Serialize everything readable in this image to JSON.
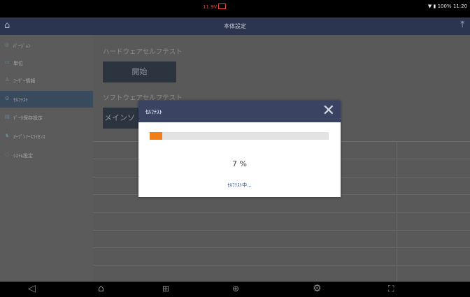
{
  "status_bar": {
    "voltage": "11.9V",
    "right_text": "▼ ▮ 100% 11:20"
  },
  "title_bar": {
    "title": "本体設定"
  },
  "sidebar": {
    "items": [
      {
        "label": "ﾊﾞｰｼﾞｮﾝ",
        "icon": "version-icon"
      },
      {
        "label": "単位",
        "icon": "unit-icon"
      },
      {
        "label": "ﾕｰｻﾞｰ情報",
        "icon": "user-icon"
      },
      {
        "label": "ｾﾙﾌﾃｽﾄ",
        "icon": "selftest-icon",
        "active": true
      },
      {
        "label": "ﾃﾞｰﾀ保存設定",
        "icon": "save-icon"
      },
      {
        "label": "ｵｰﾌﾟﾝｿｰｽﾗｲｾﾝｽ",
        "icon": "license-icon"
      },
      {
        "label": "ｼｽﾃﾑ設定",
        "icon": "system-icon"
      }
    ]
  },
  "main": {
    "hardware_title": "ハードウェアセルフテスト",
    "start_label": "開始",
    "software_title": "ソフトウェアセルフテスト",
    "mainsoft_label": "メインソ"
  },
  "dialog": {
    "title": "ｾﾙﾌﾃｽﾄ",
    "progress_percent": 7,
    "progress_text": "7 %",
    "message": "ｾﾙﾌﾃｽﾄ中...",
    "accent_color": "#f07f1a"
  },
  "nav_bar": {
    "icons": [
      "back-icon",
      "home-icon",
      "apps-icon",
      "globe-icon",
      "settings-icon",
      "screenshot-icon"
    ]
  }
}
